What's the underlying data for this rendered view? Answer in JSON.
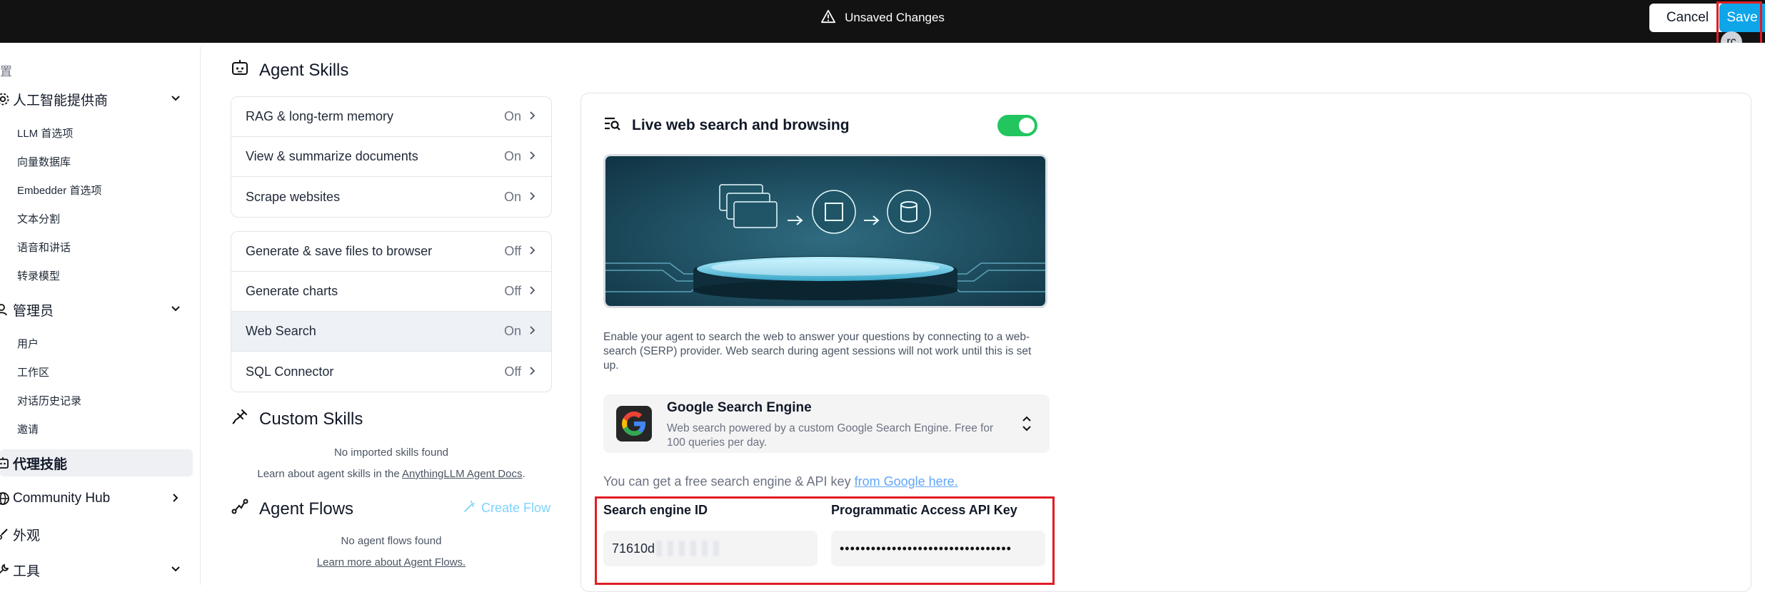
{
  "topbar": {
    "status": "Unsaved Changes",
    "cancel_label": "Cancel",
    "save_label": "Save",
    "avatar_text": "rc"
  },
  "sidebar": {
    "caption": "置",
    "sections": [
      {
        "label": "人工智能提供商",
        "icon": "gear-icon",
        "expanded": true,
        "items": [
          "LLM 首选项",
          "向量数据库",
          "Embedder 首选项",
          "文本分割",
          "语音和讲话",
          "转录模型"
        ]
      },
      {
        "label": "管理员",
        "icon": "admin-icon",
        "expanded": true,
        "items": [
          "用户",
          "工作区",
          "对话历史记录",
          "邀请"
        ]
      },
      {
        "label": "代理技能",
        "icon": "robot-icon",
        "active": true
      },
      {
        "label": "Community Hub",
        "icon": "globe-icon"
      },
      {
        "label": "外观",
        "icon": "brush-icon"
      },
      {
        "label": "工具",
        "icon": "wrench-icon"
      }
    ]
  },
  "agent_skills": {
    "title": "Agent Skills",
    "group1": [
      {
        "name": "RAG & long-term memory",
        "state": "On"
      },
      {
        "name": "View & summarize documents",
        "state": "On"
      },
      {
        "name": "Scrape websites",
        "state": "On"
      }
    ],
    "group2": [
      {
        "name": "Generate & save files to browser",
        "state": "Off"
      },
      {
        "name": "Generate charts",
        "state": "Off"
      },
      {
        "name": "Web Search",
        "state": "On",
        "selected": true
      },
      {
        "name": "SQL Connector",
        "state": "Off"
      }
    ]
  },
  "custom_skills": {
    "title": "Custom Skills",
    "empty": "No imported skills found",
    "learn_prefix": "Learn about agent skills in the ",
    "learn_link": "AnythingLLM Agent Docs",
    "learn_suffix": "."
  },
  "agent_flows": {
    "title": "Agent Flows",
    "create_label": "Create Flow",
    "empty": "No agent flows found",
    "learn_link": "Learn more about Agent Flows."
  },
  "detail": {
    "title": "Live web search and browsing",
    "enabled": true,
    "description": "Enable your agent to search the web to answer your questions by connecting to a web-search (SERP) provider. Web search during agent sessions will not work until this is set up.",
    "provider": {
      "name": "Google Search Engine",
      "description": "Web search powered by a custom Google Search Engine. Free for 100 queries per day."
    },
    "hint_prefix": "You can get a free search engine & API key ",
    "hint_link": "from Google here.",
    "fields": {
      "engine_id_label": "Search engine ID",
      "engine_id_value": "71610d",
      "api_key_label": "Programmatic Access API Key",
      "api_key_value": "•••••••••••••••••••••••••••••••••"
    }
  },
  "colors": {
    "topbar_bg": "#121212",
    "save_button": "#0ea5e9",
    "toggle_on": "#22c55e",
    "highlight": "#e11d24",
    "link": "#60a5fa"
  }
}
